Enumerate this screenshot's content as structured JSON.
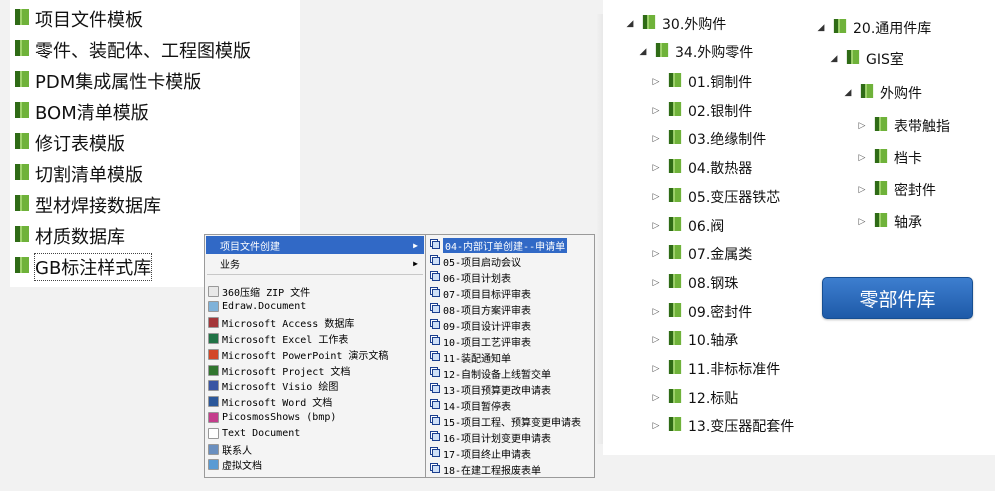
{
  "left_folders": [
    {
      "label": "项目文件模板"
    },
    {
      "label": "零件、装配体、工程图模版"
    },
    {
      "label": "PDM集成属性卡模版"
    },
    {
      "label": "BOM清单模版"
    },
    {
      "label": "修订表模版"
    },
    {
      "label": "切割清单模版"
    },
    {
      "label": "型材焊接数据库"
    },
    {
      "label": "材质数据库"
    },
    {
      "label": "GB标注样式库"
    }
  ],
  "tree_purchased": {
    "root": "30.外购件",
    "child": "34.外购零件",
    "items": [
      "01.铜制件",
      "02.银制件",
      "03.绝缘制件",
      "04.散热器",
      "05.变压器铁芯",
      "06.阀",
      "07.金属类",
      "08.钢珠",
      "09.密封件",
      "10.轴承",
      "11.非标标准件",
      "12.标贴",
      "13.变压器配套件"
    ]
  },
  "tree_general": {
    "root": "20.通用件库",
    "child": "GIS室",
    "grandchild": "外购件",
    "items": [
      "表带触指",
      "档卡",
      "密封件",
      "轴承"
    ]
  },
  "library_badge": "零部件库",
  "context_menu": {
    "items": [
      {
        "label": "项目文件创建",
        "submenu": true,
        "highlighted": true
      },
      {
        "label": "业务",
        "submenu": true,
        "highlighted": false
      }
    ],
    "new_items": [
      {
        "label": "360压缩 ZIP 文件",
        "color": "#e8e8e8"
      },
      {
        "label": "Edraw.Document",
        "color": "#7fb2d9"
      },
      {
        "label": "Microsoft Access 数据库",
        "color": "#a4373a"
      },
      {
        "label": "Microsoft Excel 工作表",
        "color": "#217346"
      },
      {
        "label": "Microsoft PowerPoint 演示文稿",
        "color": "#d24726"
      },
      {
        "label": "Microsoft Project 文档",
        "color": "#31752f"
      },
      {
        "label": "Microsoft Visio 绘图",
        "color": "#3955a3"
      },
      {
        "label": "Microsoft Word 文档",
        "color": "#2b579a"
      },
      {
        "label": "PicosmosShows (bmp)",
        "color": "#c43e8c"
      },
      {
        "label": "Text Document",
        "color": "#ffffff"
      },
      {
        "label": "联系人",
        "color": "#6a8fbf"
      },
      {
        "label": "虚拟文档",
        "color": "#5a9bd4"
      }
    ]
  },
  "submenu": {
    "items": [
      "04-内部订单创建--申请单",
      "05-项目启动会议",
      "06-项目计划表",
      "07-项目目标评审表",
      "08-项目方案评审表",
      "09-项目设计评审表",
      "10-项目工艺评审表",
      "11-装配通知单",
      "12-自制设备上线暂交单",
      "13-项目预算更改申请表",
      "14-项目暂停表",
      "15-项目工程、预算变更申请表",
      "16-项目计划变更申请表",
      "17-项目终止申请表",
      "18-在建工程报废表单"
    ]
  },
  "colors": {
    "folder_green": "#6fb23a",
    "folder_dark": "#2f6b16",
    "highlight": "#3169c6",
    "badge": "#2a69b8"
  }
}
